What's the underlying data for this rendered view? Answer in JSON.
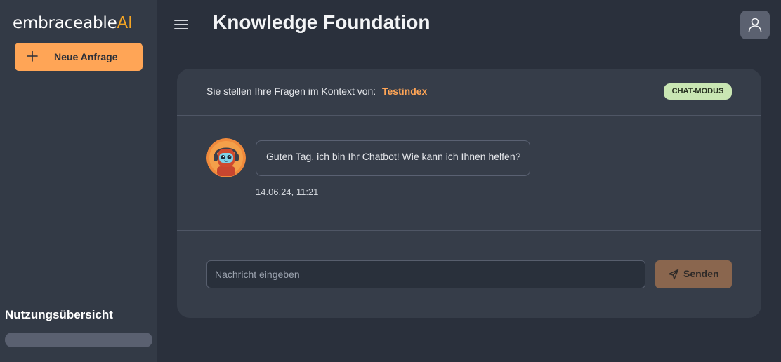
{
  "brand": {
    "name": "embraceable",
    "suffix": "AI"
  },
  "sidebar": {
    "new_request_label": "Neue Anfrage",
    "usage_title": "Nutzungsübersicht",
    "usage_progress": 0
  },
  "header": {
    "title": "Knowledge Foundation"
  },
  "context": {
    "prefix": "Sie stellen Ihre Fragen im Kontext von:",
    "index_name": "Testindex",
    "mode_badge": "CHAT-MODUS"
  },
  "chat": {
    "messages": [
      {
        "sender": "bot",
        "text": "Guten Tag, ich bin Ihr Chatbot! Wie kann ich Ihnen helfen?",
        "timestamp": "14.06.24, 11:21"
      }
    ]
  },
  "composer": {
    "placeholder": "Nachricht eingeben",
    "value": "",
    "send_label": "Senden"
  },
  "icons": {
    "menu": "hamburger-menu-icon",
    "user": "user-icon",
    "plus": "plus-icon",
    "send": "send-icon",
    "avatar": "robot-avatar-icon"
  },
  "colors": {
    "accent": "#ffa556",
    "brand_ai": "#f5a524",
    "badge_bg": "#c9e6b3",
    "send_button": "#8a664e"
  }
}
